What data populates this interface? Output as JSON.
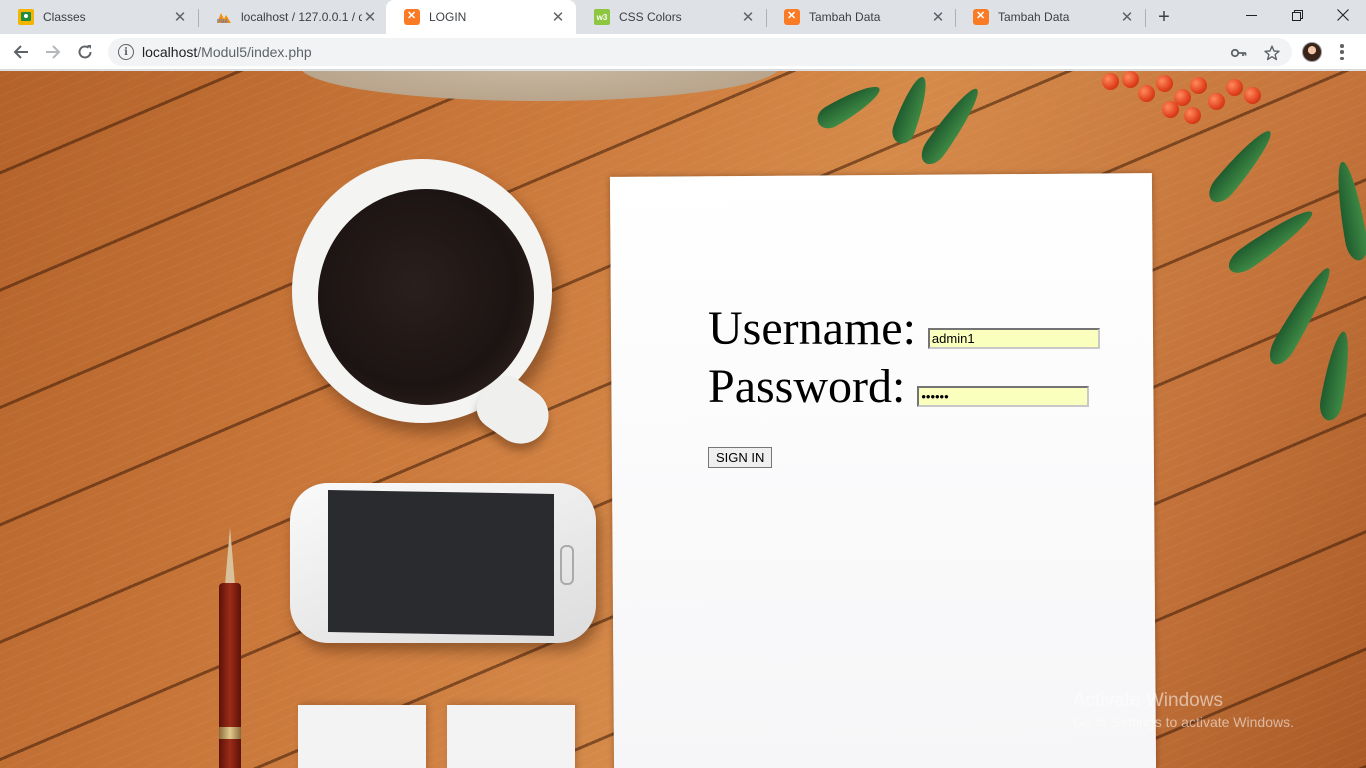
{
  "tabs": [
    {
      "title": "Classes",
      "icon": "google-classroom-icon"
    },
    {
      "title": "localhost / 127.0.0.1 / d",
      "icon": "phpmyadmin-icon"
    },
    {
      "title": "LOGIN",
      "icon": "xampp-icon",
      "active": true
    },
    {
      "title": "CSS Colors",
      "icon": "w3schools-icon"
    },
    {
      "title": "Tambah Data",
      "icon": "xampp-icon"
    },
    {
      "title": "Tambah Data",
      "icon": "xampp-icon"
    }
  ],
  "address_bar": {
    "host": "localhost",
    "path": "/Modul5/index.php"
  },
  "login_form": {
    "username_label": "Username:",
    "username_value": "admin1",
    "password_label": "Password:",
    "password_value": "admin1",
    "submit_label": "SIGN IN",
    "autofill_color": "#faffbd"
  },
  "watermark": {
    "line1": "Activate Windows",
    "line2": "Go to Settings to activate Windows."
  }
}
